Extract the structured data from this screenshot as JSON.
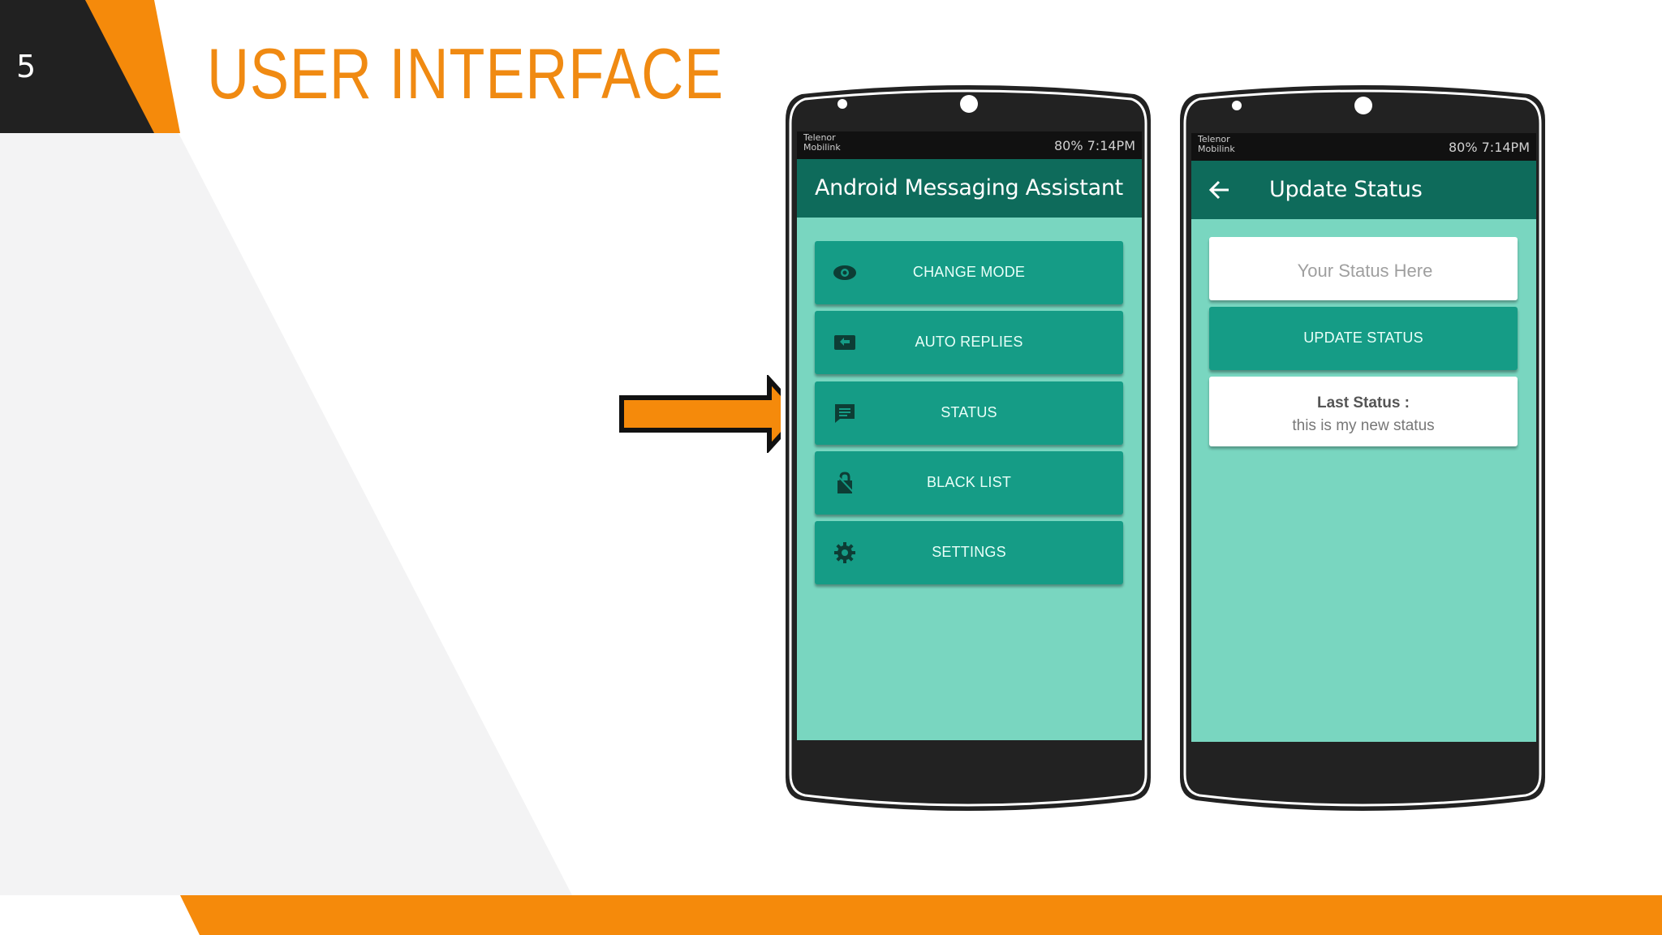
{
  "slide": {
    "number": "5",
    "title": "USER INTERFACE"
  },
  "colors": {
    "accent_orange": "#f58a0b",
    "dark": "#212121",
    "app_bar": "#0e6b5b",
    "button_teal": "#159c86",
    "screen_bg": "#79d6c0"
  },
  "phone1": {
    "status_bar": {
      "carrier_line1": "Telenor",
      "carrier_line2": "Mobilink",
      "right_text": "80% 7:14PM"
    },
    "app_title": "Android Messaging Assistant",
    "menu": [
      {
        "label": "CHANGE MODE",
        "icon": "eye-icon"
      },
      {
        "label": "AUTO REPLIES",
        "icon": "reply-icon"
      },
      {
        "label": "STATUS",
        "icon": "message-icon"
      },
      {
        "label": "BLACK LIST",
        "icon": "lock-icon"
      },
      {
        "label": "SETTINGS",
        "icon": "gear-icon"
      }
    ]
  },
  "phone2": {
    "status_bar": {
      "carrier_line1": "Telenor",
      "carrier_line2": "Mobilink",
      "right_text": "80% 7:14PM"
    },
    "app_title": "Update Status",
    "status_placeholder": "Your Status Here",
    "update_button": "UPDATE STATUS",
    "last_status_label": "Last Status :",
    "last_status_value": "this is my new status"
  },
  "arrow_icon": "arrow-right-icon"
}
